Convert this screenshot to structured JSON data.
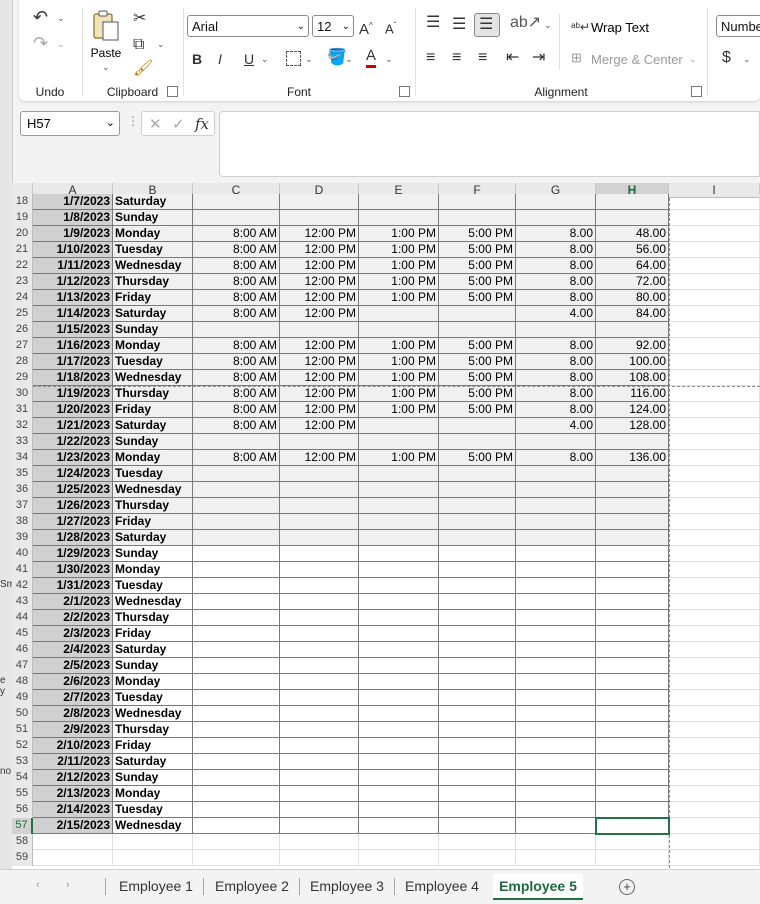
{
  "left_strip_fragments": [
    "Sm",
    "e y",
    "no"
  ],
  "ribbon": {
    "undo": {
      "label": "Undo"
    },
    "clipboard": {
      "label": "Clipboard",
      "paste": "Paste"
    },
    "font": {
      "label": "Font",
      "name": "Arial",
      "size": "12",
      "bold": "B",
      "italic": "I",
      "underline": "U"
    },
    "alignment": {
      "label": "Alignment",
      "wrap_text": "Wrap Text",
      "merge_center": "Merge & Center"
    },
    "number": {
      "format": "Number",
      "currency": "$"
    }
  },
  "formula_bar": {
    "name_box": "H57",
    "fx": "fx",
    "content": ""
  },
  "columns": [
    "A",
    "B",
    "C",
    "D",
    "E",
    "F",
    "G",
    "H",
    "I"
  ],
  "selected_column": "H",
  "selected_row": "57",
  "rows": [
    {
      "n": "18",
      "date": "1/7/2023",
      "day": "Saturday",
      "c": "",
      "d": "",
      "e": "",
      "f": "",
      "g": "",
      "h": "",
      "shade": true
    },
    {
      "n": "19",
      "date": "1/8/2023",
      "day": "Sunday",
      "c": "",
      "d": "",
      "e": "",
      "f": "",
      "g": "",
      "h": "",
      "shade": true
    },
    {
      "n": "20",
      "date": "1/9/2023",
      "day": "Monday",
      "c": "8:00 AM",
      "d": "12:00 PM",
      "e": "1:00 PM",
      "f": "5:00 PM",
      "g": "8.00",
      "h": "48.00",
      "shade": true
    },
    {
      "n": "21",
      "date": "1/10/2023",
      "day": "Tuesday",
      "c": "8:00 AM",
      "d": "12:00 PM",
      "e": "1:00 PM",
      "f": "5:00 PM",
      "g": "8.00",
      "h": "56.00",
      "shade": true
    },
    {
      "n": "22",
      "date": "1/11/2023",
      "day": "Wednesday",
      "c": "8:00 AM",
      "d": "12:00 PM",
      "e": "1:00 PM",
      "f": "5:00 PM",
      "g": "8.00",
      "h": "64.00",
      "shade": true
    },
    {
      "n": "23",
      "date": "1/12/2023",
      "day": "Thursday",
      "c": "8:00 AM",
      "d": "12:00 PM",
      "e": "1:00 PM",
      "f": "5:00 PM",
      "g": "8.00",
      "h": "72.00",
      "shade": true
    },
    {
      "n": "24",
      "date": "1/13/2023",
      "day": "Friday",
      "c": "8:00 AM",
      "d": "12:00 PM",
      "e": "1:00 PM",
      "f": "5:00 PM",
      "g": "8.00",
      "h": "80.00",
      "shade": true
    },
    {
      "n": "25",
      "date": "1/14/2023",
      "day": "Saturday",
      "c": "8:00 AM",
      "d": "12:00 PM",
      "e": "",
      "f": "",
      "g": "4.00",
      "h": "84.00",
      "shade": true
    },
    {
      "n": "26",
      "date": "1/15/2023",
      "day": "Sunday",
      "c": "",
      "d": "",
      "e": "",
      "f": "",
      "g": "",
      "h": "",
      "shade": true
    },
    {
      "n": "27",
      "date": "1/16/2023",
      "day": "Monday",
      "c": "8:00 AM",
      "d": "12:00 PM",
      "e": "1:00 PM",
      "f": "5:00 PM",
      "g": "8.00",
      "h": "92.00",
      "shade": true
    },
    {
      "n": "28",
      "date": "1/17/2023",
      "day": "Tuesday",
      "c": "8:00 AM",
      "d": "12:00 PM",
      "e": "1:00 PM",
      "f": "5:00 PM",
      "g": "8.00",
      "h": "100.00",
      "shade": true
    },
    {
      "n": "29",
      "date": "1/18/2023",
      "day": "Wednesday",
      "c": "8:00 AM",
      "d": "12:00 PM",
      "e": "1:00 PM",
      "f": "5:00 PM",
      "g": "8.00",
      "h": "108.00",
      "shade": true
    },
    {
      "n": "30",
      "date": "1/19/2023",
      "day": "Thursday",
      "c": "8:00 AM",
      "d": "12:00 PM",
      "e": "1:00 PM",
      "f": "5:00 PM",
      "g": "8.00",
      "h": "116.00",
      "shade": true
    },
    {
      "n": "31",
      "date": "1/20/2023",
      "day": "Friday",
      "c": "8:00 AM",
      "d": "12:00 PM",
      "e": "1:00 PM",
      "f": "5:00 PM",
      "g": "8.00",
      "h": "124.00",
      "shade": true
    },
    {
      "n": "32",
      "date": "1/21/2023",
      "day": "Saturday",
      "c": "8:00 AM",
      "d": "12:00 PM",
      "e": "",
      "f": "",
      "g": "4.00",
      "h": "128.00",
      "shade": true
    },
    {
      "n": "33",
      "date": "1/22/2023",
      "day": "Sunday",
      "c": "",
      "d": "",
      "e": "",
      "f": "",
      "g": "",
      "h": "",
      "shade": true
    },
    {
      "n": "34",
      "date": "1/23/2023",
      "day": "Monday",
      "c": "8:00 AM",
      "d": "12:00 PM",
      "e": "1:00 PM",
      "f": "5:00 PM",
      "g": "8.00",
      "h": "136.00",
      "shade": true
    },
    {
      "n": "35",
      "date": "1/24/2023",
      "day": "Tuesday",
      "c": "",
      "d": "",
      "e": "",
      "f": "",
      "g": "",
      "h": "",
      "shade": true
    },
    {
      "n": "36",
      "date": "1/25/2023",
      "day": "Wednesday",
      "c": "",
      "d": "",
      "e": "",
      "f": "",
      "g": "",
      "h": "",
      "shade": true
    },
    {
      "n": "37",
      "date": "1/26/2023",
      "day": "Thursday",
      "c": "",
      "d": "",
      "e": "",
      "f": "",
      "g": "",
      "h": "",
      "shade": true
    },
    {
      "n": "38",
      "date": "1/27/2023",
      "day": "Friday",
      "c": "",
      "d": "",
      "e": "",
      "f": "",
      "g": "",
      "h": "",
      "shade": true
    },
    {
      "n": "39",
      "date": "1/28/2023",
      "day": "Saturday",
      "c": "",
      "d": "",
      "e": "",
      "f": "",
      "g": "",
      "h": "",
      "shade": true
    },
    {
      "n": "40",
      "date": "1/29/2023",
      "day": "Sunday",
      "c": "",
      "d": "",
      "e": "",
      "f": "",
      "g": "",
      "h": "",
      "shade": false
    },
    {
      "n": "41",
      "date": "1/30/2023",
      "day": "Monday",
      "c": "",
      "d": "",
      "e": "",
      "f": "",
      "g": "",
      "h": "",
      "shade": false
    },
    {
      "n": "42",
      "date": "1/31/2023",
      "day": "Tuesday",
      "c": "",
      "d": "",
      "e": "",
      "f": "",
      "g": "",
      "h": "",
      "shade": false
    },
    {
      "n": "43",
      "date": "2/1/2023",
      "day": "Wednesday",
      "c": "",
      "d": "",
      "e": "",
      "f": "",
      "g": "",
      "h": "",
      "shade": false
    },
    {
      "n": "44",
      "date": "2/2/2023",
      "day": "Thursday",
      "c": "",
      "d": "",
      "e": "",
      "f": "",
      "g": "",
      "h": "",
      "shade": false
    },
    {
      "n": "45",
      "date": "2/3/2023",
      "day": "Friday",
      "c": "",
      "d": "",
      "e": "",
      "f": "",
      "g": "",
      "h": "",
      "shade": false
    },
    {
      "n": "46",
      "date": "2/4/2023",
      "day": "Saturday",
      "c": "",
      "d": "",
      "e": "",
      "f": "",
      "g": "",
      "h": "",
      "shade": false
    },
    {
      "n": "47",
      "date": "2/5/2023",
      "day": "Sunday",
      "c": "",
      "d": "",
      "e": "",
      "f": "",
      "g": "",
      "h": "",
      "shade": false
    },
    {
      "n": "48",
      "date": "2/6/2023",
      "day": "Monday",
      "c": "",
      "d": "",
      "e": "",
      "f": "",
      "g": "",
      "h": "",
      "shade": false
    },
    {
      "n": "49",
      "date": "2/7/2023",
      "day": "Tuesday",
      "c": "",
      "d": "",
      "e": "",
      "f": "",
      "g": "",
      "h": "",
      "shade": false
    },
    {
      "n": "50",
      "date": "2/8/2023",
      "day": "Wednesday",
      "c": "",
      "d": "",
      "e": "",
      "f": "",
      "g": "",
      "h": "",
      "shade": false
    },
    {
      "n": "51",
      "date": "2/9/2023",
      "day": "Thursday",
      "c": "",
      "d": "",
      "e": "",
      "f": "",
      "g": "",
      "h": "",
      "shade": false
    },
    {
      "n": "52",
      "date": "2/10/2023",
      "day": "Friday",
      "c": "",
      "d": "",
      "e": "",
      "f": "",
      "g": "",
      "h": "",
      "shade": false
    },
    {
      "n": "53",
      "date": "2/11/2023",
      "day": "Saturday",
      "c": "",
      "d": "",
      "e": "",
      "f": "",
      "g": "",
      "h": "",
      "shade": false
    },
    {
      "n": "54",
      "date": "2/12/2023",
      "day": "Sunday",
      "c": "",
      "d": "",
      "e": "",
      "f": "",
      "g": "",
      "h": "",
      "shade": false
    },
    {
      "n": "55",
      "date": "2/13/2023",
      "day": "Monday",
      "c": "",
      "d": "",
      "e": "",
      "f": "",
      "g": "",
      "h": "",
      "shade": false
    },
    {
      "n": "56",
      "date": "2/14/2023",
      "day": "Tuesday",
      "c": "",
      "d": "",
      "e": "",
      "f": "",
      "g": "",
      "h": "",
      "shade": false
    },
    {
      "n": "57",
      "date": "2/15/2023",
      "day": "Wednesday",
      "c": "",
      "d": "",
      "e": "",
      "f": "",
      "g": "",
      "h": "",
      "shade": false
    },
    {
      "n": "58",
      "date": "",
      "day": "",
      "c": "",
      "d": "",
      "e": "",
      "f": "",
      "g": "",
      "h": "",
      "shade": false,
      "empty": true
    },
    {
      "n": "59",
      "date": "",
      "day": "",
      "c": "",
      "d": "",
      "e": "",
      "f": "",
      "g": "",
      "h": "",
      "shade": false,
      "empty": true
    }
  ],
  "sheet_tabs": [
    "Employee 1",
    "Employee 2",
    "Employee 3",
    "Employee 4",
    "Employee 5"
  ],
  "active_tab": "Employee 5",
  "colors": {
    "accent": "#217346",
    "shade": "#f0f0f0",
    "date_shade": "#d0d0d0"
  }
}
